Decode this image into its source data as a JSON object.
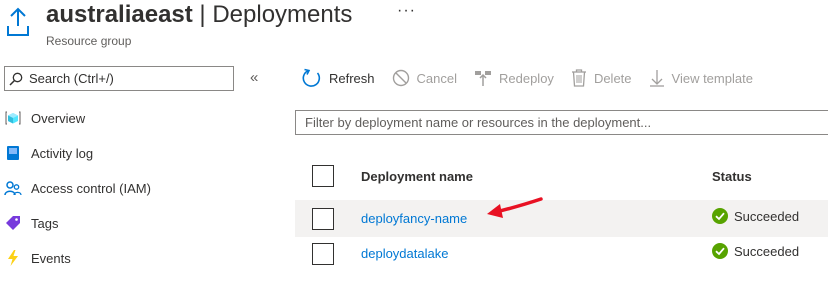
{
  "header": {
    "resource_name": "australiaeast",
    "separator": " | ",
    "page_name": "Deployments",
    "more_label": "···",
    "subtitle": "Resource group"
  },
  "sidebar": {
    "search_placeholder": "Search (Ctrl+/)",
    "collapse_label": "«",
    "items": [
      {
        "label": "Overview",
        "icon": "resource-group-cube-icon"
      },
      {
        "label": "Activity log",
        "icon": "activity-log-icon"
      },
      {
        "label": "Access control (IAM)",
        "icon": "people-icon"
      },
      {
        "label": "Tags",
        "icon": "tag-icon"
      },
      {
        "label": "Events",
        "icon": "lightning-bolt-icon"
      }
    ]
  },
  "toolbar": {
    "refresh": "Refresh",
    "cancel": "Cancel",
    "redeploy": "Redeploy",
    "delete": "Delete",
    "view_template": "View template"
  },
  "filter": {
    "placeholder": "Filter by deployment name or resources in the deployment..."
  },
  "table": {
    "columns": [
      "Deployment name",
      "Status"
    ],
    "rows": [
      {
        "name": "deployfancy-name",
        "status": "Succeeded",
        "highlighted": true
      },
      {
        "name": "deploydatalake",
        "status": "Succeeded",
        "highlighted": false
      }
    ]
  },
  "colors": {
    "accent": "#0078d4",
    "success": "#57a300",
    "annotation_arrow": "#e81123"
  }
}
